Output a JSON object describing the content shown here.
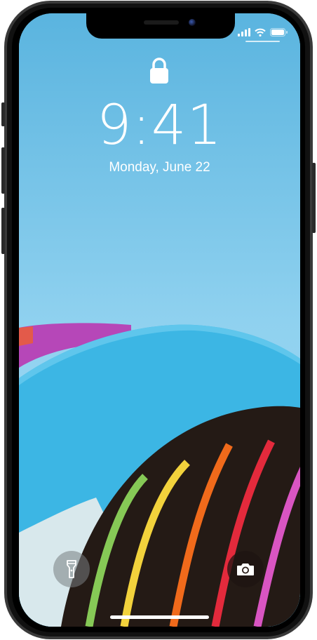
{
  "lock_screen": {
    "time": "9:41",
    "date": "Monday, June 22"
  },
  "icons": {
    "lock": "lock-icon",
    "flashlight": "flashlight-icon",
    "camera": "camera-icon",
    "signal": "cellular-signal-icon",
    "wifi": "wifi-icon",
    "battery": "battery-icon"
  },
  "colors": {
    "sky_top": "#5db6e0",
    "sky_bottom": "#8fd0ee",
    "band_blue": "#3cb6e4",
    "band_magenta": "#b647b8",
    "arch_dark": "#241a15",
    "stripe_red": "#e32a3c",
    "stripe_orange": "#f06a1b",
    "stripe_yellow": "#f2d23c",
    "stripe_green": "#86c956",
    "stripe_pink": "#d955c2"
  }
}
